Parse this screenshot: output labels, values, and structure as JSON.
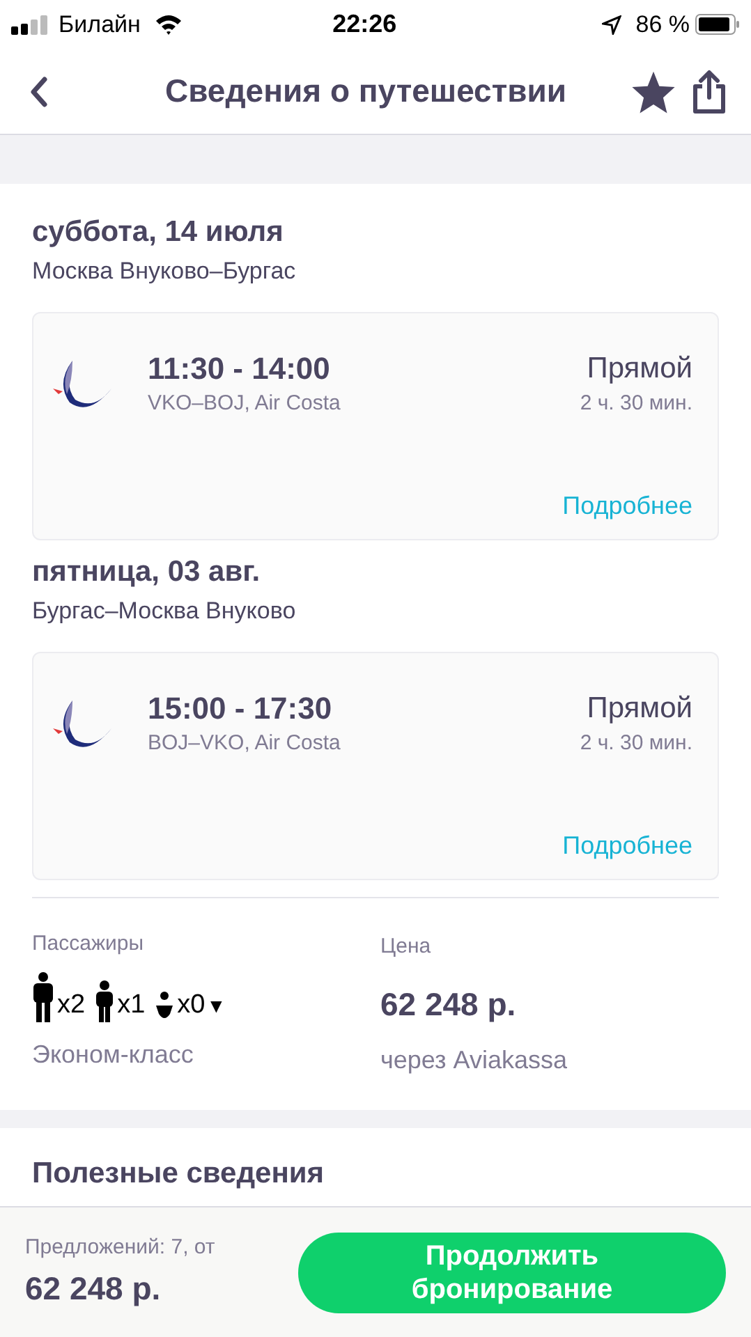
{
  "status_bar": {
    "carrier": "Билайн",
    "time": "22:26",
    "battery": "86 %"
  },
  "nav": {
    "title": "Сведения о путешествии"
  },
  "legs": [
    {
      "date": "суббота, 14 июля",
      "route": "Москва Внуково–Бургас",
      "times": "11:30 - 14:00",
      "details": "VKO–BOJ, Air Costa",
      "type": "Прямой",
      "duration": "2 ч. 30 мин.",
      "link": "Подробнее"
    },
    {
      "date": "пятница, 03 авг.",
      "route": "Бургас–Москва Внуково",
      "times": "15:00 - 17:30",
      "details": "BOJ–VKO, Air Costa",
      "type": "Прямой",
      "duration": "2 ч. 30 мин.",
      "link": "Подробнее"
    }
  ],
  "passengers": {
    "label": "Пассажиры",
    "counts": [
      {
        "kind": "adult",
        "count": "x2"
      },
      {
        "kind": "child",
        "count": "x1"
      },
      {
        "kind": "infant",
        "count": "x0"
      }
    ],
    "caret": "▼",
    "class": "Эконом-класс"
  },
  "price": {
    "label": "Цена",
    "amount": "62 248 р.",
    "via": "через Aviakassa"
  },
  "useful_heading": "Полезные сведения",
  "bottom_bar": {
    "offers": "Предложений: 7, от",
    "price": "62 248 р.",
    "button": "Продолжить бронирование"
  }
}
